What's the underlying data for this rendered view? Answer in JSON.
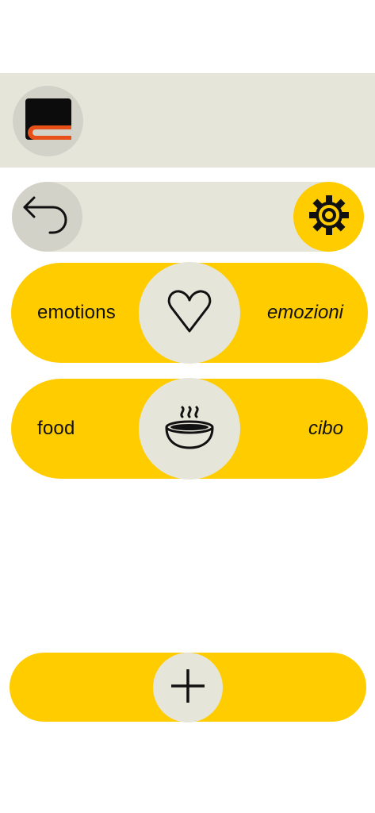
{
  "colors": {
    "accent": "#ffcc00",
    "panel": "#e6e5da",
    "circle_gray": "#d3d2c8",
    "logo_orange": "#e8501a"
  },
  "header": {
    "logo_icon": "book-logo-icon"
  },
  "nav": {
    "back_icon": "back-arrow-icon",
    "settings_icon": "gear-icon"
  },
  "categories": [
    {
      "label_en": "emotions",
      "label_it": "emozioni",
      "icon": "heart-icon"
    },
    {
      "label_en": "food",
      "label_it": "cibo",
      "icon": "soup-bowl-icon"
    }
  ],
  "footer": {
    "add_icon": "plus-icon"
  }
}
